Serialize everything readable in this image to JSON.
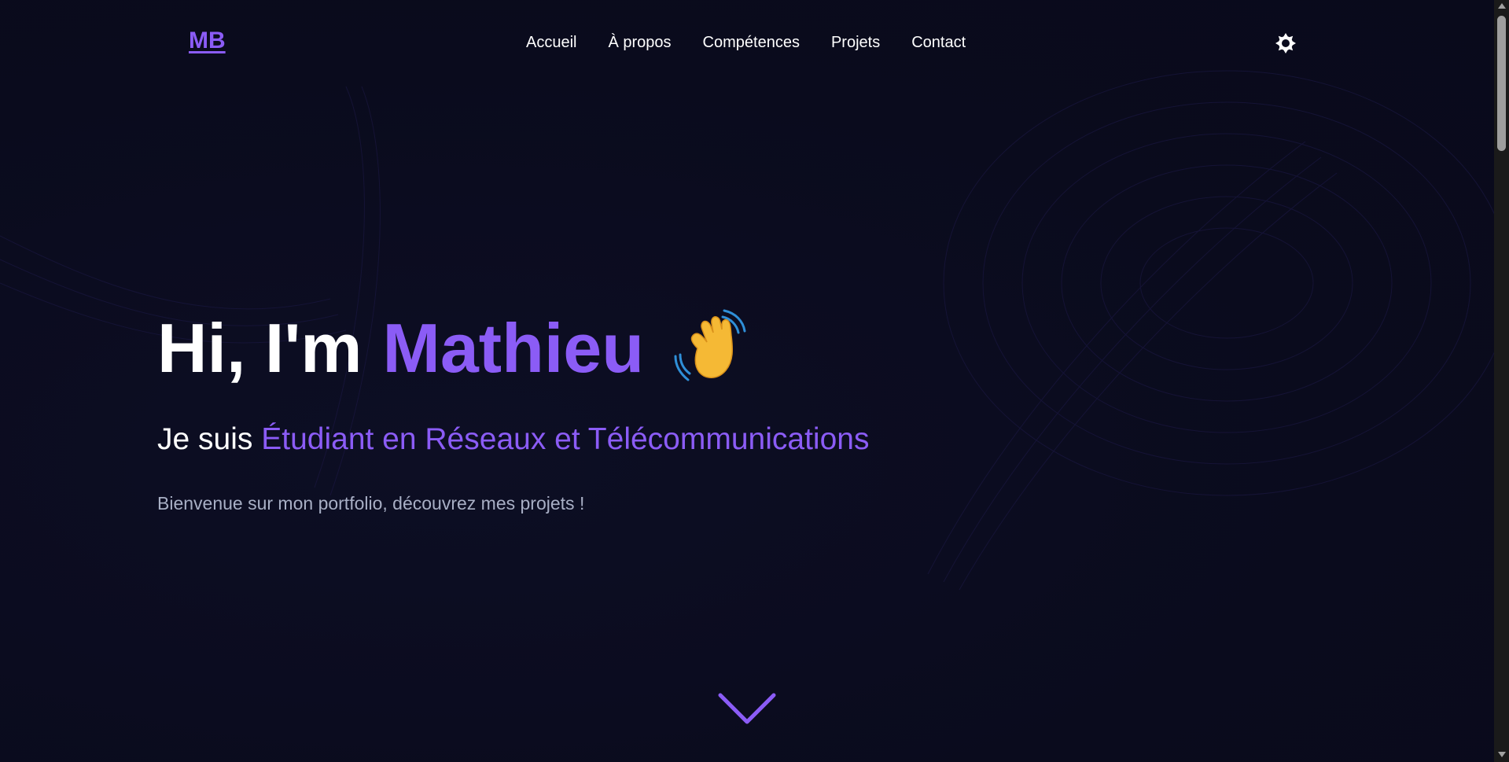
{
  "navbar": {
    "logo": "MB",
    "links": [
      "Accueil",
      "À propos",
      "Compétences",
      "Projets",
      "Contact"
    ],
    "theme_toggle_icon": "sun-icon"
  },
  "hero": {
    "greeting": "Hi, I'm",
    "name": "Mathieu",
    "wave_icon": "waving-hand-icon",
    "subtitle_prefix": "Je suis",
    "subtitle_role": "Étudiant en Réseaux et Télécommunications",
    "description": "Bienvenue sur mon portfolio, découvrez mes projets !",
    "scroll_icon": "chevron-down-icon"
  },
  "colors": {
    "background": "#0a0b1d",
    "accent": "#8b5cf6",
    "text": "#ffffff",
    "muted_text": "#a8afc5"
  }
}
